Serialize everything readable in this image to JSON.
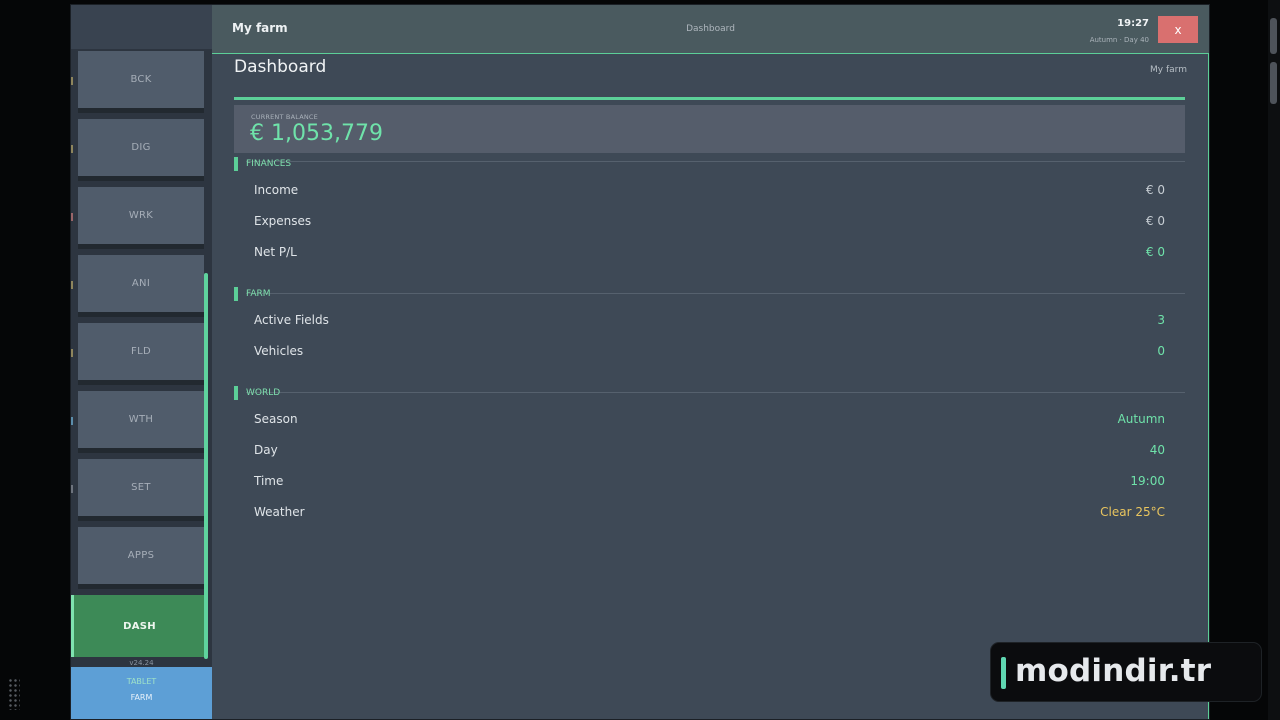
{
  "sidebar": {
    "items": [
      {
        "label": "BCK"
      },
      {
        "label": "DIG"
      },
      {
        "label": "WRK"
      },
      {
        "label": "ANI"
      },
      {
        "label": "FLD"
      },
      {
        "label": "WTH"
      },
      {
        "label": "SET"
      },
      {
        "label": "APPS"
      },
      {
        "label": "DASH",
        "active": true
      }
    ],
    "version": "v24.24",
    "footer_line1": "TABLET",
    "footer_line2": "FARM"
  },
  "topbar": {
    "title": "My farm",
    "center": "Dashboard",
    "clock": "19:27",
    "subtitle": "Autumn · Day 40",
    "close_label": "x"
  },
  "page": {
    "title": "Dashboard",
    "breadcrumb": "My farm"
  },
  "balance": {
    "label": "CURRENT BALANCE",
    "value": "€ 1,053,779"
  },
  "sections": {
    "finances": {
      "title": "FINANCES",
      "rows": [
        {
          "label": "Income",
          "value": "€ 0"
        },
        {
          "label": "Expenses",
          "value": "€ 0"
        },
        {
          "label": "Net P/L",
          "value": "€ 0"
        }
      ]
    },
    "farm": {
      "title": "FARM",
      "rows": [
        {
          "label": "Active Fields",
          "value": "3"
        },
        {
          "label": "Vehicles",
          "value": "0"
        }
      ]
    },
    "world": {
      "title": "WORLD",
      "rows": [
        {
          "label": "Season",
          "value": "Autumn"
        },
        {
          "label": "Day",
          "value": "40"
        },
        {
          "label": "Time",
          "value": "19:00"
        },
        {
          "label": "Weather",
          "value": "Clear  25°C"
        }
      ]
    }
  },
  "watermark": "modindir.tr",
  "colors": {
    "accent": "#5ccf98",
    "value_green": "#6fe3aa",
    "weather_yellow": "#e9c55e",
    "close_red": "#d9706f",
    "active_nav": "#3d8a57",
    "tablet_blue": "#5d9fd6"
  }
}
